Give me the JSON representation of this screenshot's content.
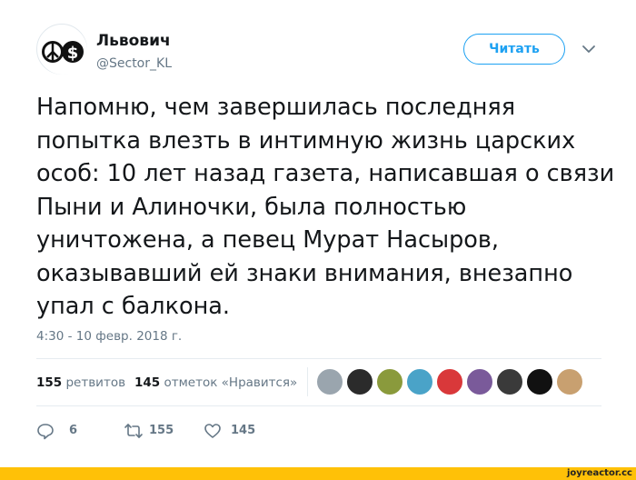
{
  "user": {
    "display_name": "Львович",
    "handle": "@Sector_KL",
    "avatar_icon": "peace-dollar-icon"
  },
  "follow_button": {
    "label": "Читать"
  },
  "menu_icon": "chevron-down-icon",
  "tweet": {
    "text": "Напомню, чем завершилась последняя попытка влезть в интимную жизнь царских особ: 10 лет назад газета, написавшая о связи Пыни и Алиночки, была полностью уничтожена, а певец Мурат Насыров, оказывавший ей знаки внимания, внезапно упал с балкона.",
    "timestamp": "4:30 - 10 февр. 2018 г."
  },
  "stats": {
    "retweets_count": "155",
    "retweets_label": "ретвитов",
    "likes_count": "145",
    "likes_label": "отметок «Нравится»"
  },
  "likers": [
    {
      "name": "liker-avatar-1",
      "color": "#9aa5ae"
    },
    {
      "name": "liker-avatar-2",
      "color": "#2b2b2b"
    },
    {
      "name": "liker-avatar-3",
      "color": "#8a9a3c"
    },
    {
      "name": "liker-avatar-4",
      "color": "#4aa3c8"
    },
    {
      "name": "liker-avatar-5",
      "color": "#d9383a"
    },
    {
      "name": "liker-avatar-6",
      "color": "#7a5a9a"
    },
    {
      "name": "liker-avatar-7",
      "color": "#3a3a3a"
    },
    {
      "name": "liker-avatar-8",
      "color": "#111111"
    },
    {
      "name": "liker-avatar-9",
      "color": "#c8a070"
    }
  ],
  "actions": {
    "reply_count": "6",
    "retweet_count": "155",
    "like_count": "145"
  },
  "footer": {
    "site": "joyreactor.cc"
  },
  "colors": {
    "accent": "#1da1f2",
    "text": "#14171a",
    "muted": "#657786",
    "footer_bar": "#ffc107"
  }
}
